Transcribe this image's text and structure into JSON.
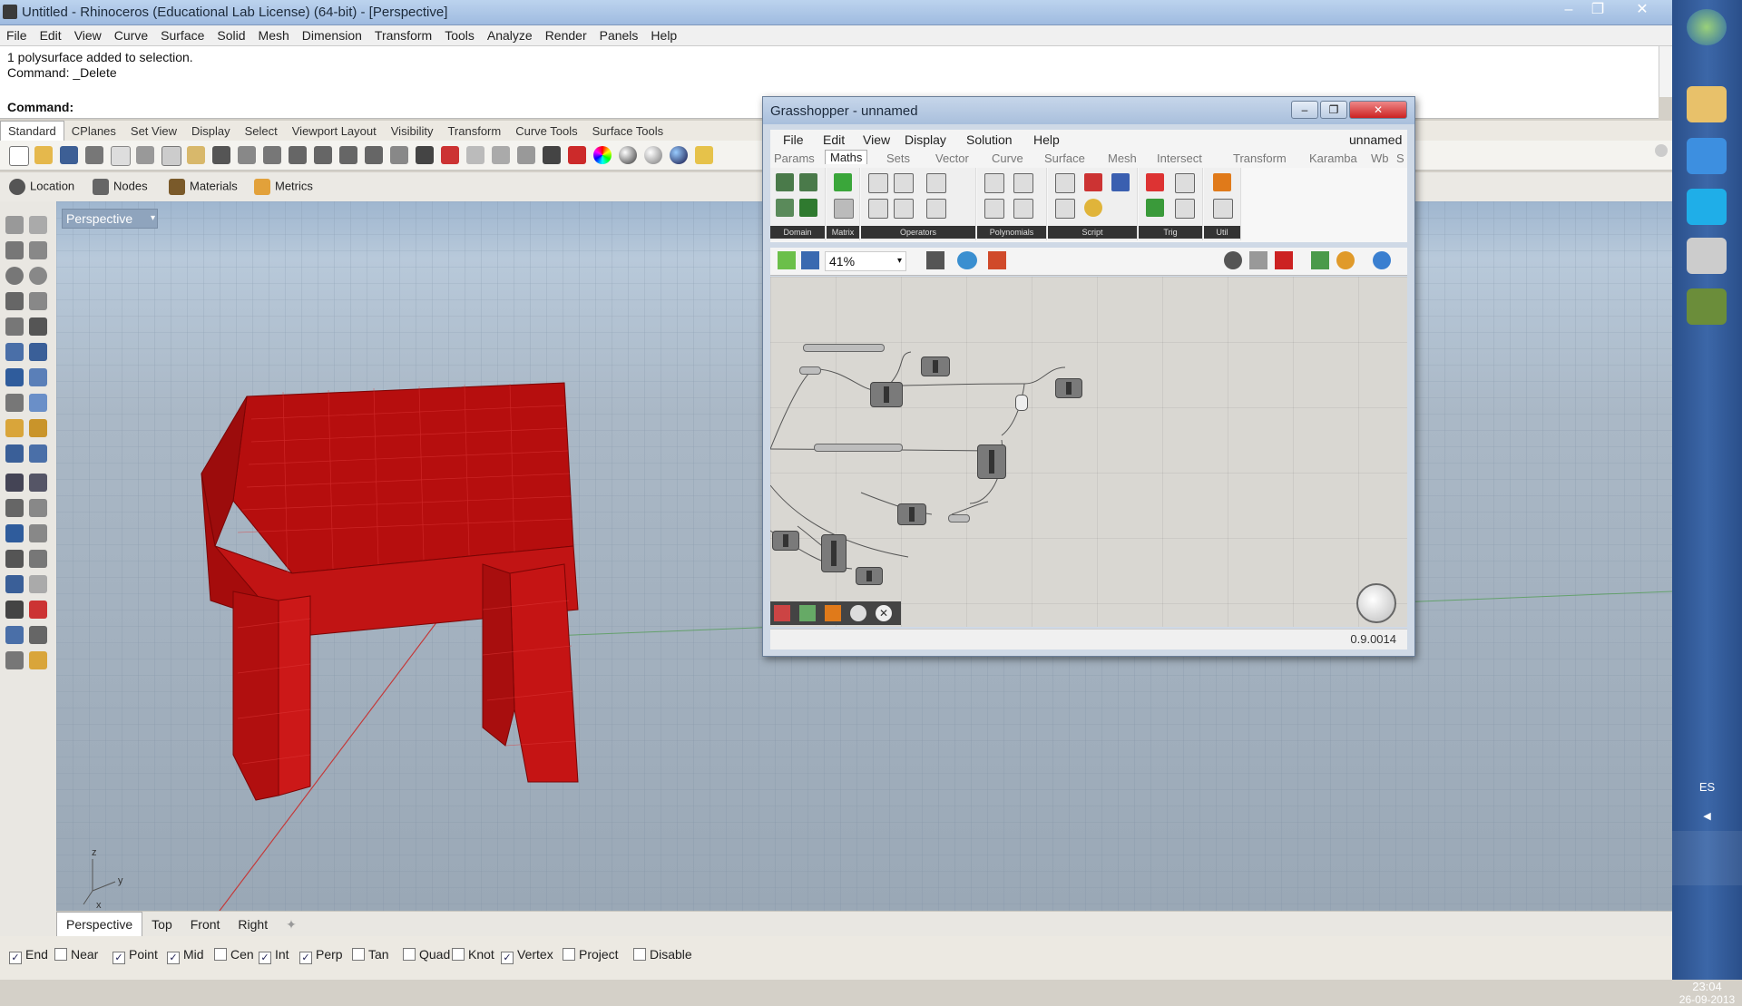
{
  "window": {
    "title": "Untitled - Rhinoceros (Educational Lab License) (64-bit) - [Perspective]",
    "controls": [
      "minimize",
      "restore",
      "close"
    ]
  },
  "menubar": [
    "File",
    "Edit",
    "View",
    "Curve",
    "Surface",
    "Solid",
    "Mesh",
    "Dimension",
    "Transform",
    "Tools",
    "Analyze",
    "Render",
    "Panels",
    "Help"
  ],
  "command": {
    "history": [
      "1 polysurface added to selection.",
      "Command: _Delete"
    ],
    "prompt": "Command:"
  },
  "toolbar_tabs": [
    "Standard",
    "CPlanes",
    "Set View",
    "Display",
    "Select",
    "Viewport Layout",
    "Visibility",
    "Transform",
    "Curve Tools",
    "Surface Tools"
  ],
  "toolbar_tabs_active": "Standard",
  "panels": [
    "Location",
    "Nodes",
    "Materials",
    "Metrics"
  ],
  "viewport": {
    "label": "Perspective",
    "axis_labels": [
      "z",
      "y",
      "x"
    ]
  },
  "viewport_tabs": [
    "Perspective",
    "Top",
    "Front",
    "Right"
  ],
  "viewport_tabs_active": "Perspective",
  "osnaps": [
    {
      "label": "End",
      "checked": true
    },
    {
      "label": "Near",
      "checked": false
    },
    {
      "label": "Point",
      "checked": true
    },
    {
      "label": "Mid",
      "checked": true
    },
    {
      "label": "Cen",
      "checked": false
    },
    {
      "label": "Int",
      "checked": true
    },
    {
      "label": "Perp",
      "checked": true
    },
    {
      "label": "Tan",
      "checked": false
    },
    {
      "label": "Quad",
      "checked": false
    },
    {
      "label": "Knot",
      "checked": false
    },
    {
      "label": "Vertex",
      "checked": true
    },
    {
      "label": "Project",
      "checked": false
    },
    {
      "label": "Disable",
      "checked": false
    }
  ],
  "grasshopper": {
    "title": "Grasshopper - unnamed",
    "doc_name": "unnamed",
    "menu": [
      "File",
      "Edit",
      "View",
      "Display",
      "Solution",
      "Help"
    ],
    "tabs": [
      "Params",
      "Maths",
      "Sets",
      "Vector",
      "Curve",
      "Surface",
      "Mesh",
      "Intersect",
      "Transform",
      "Karamba",
      "Wb",
      "S"
    ],
    "active_tab": "Maths",
    "ribbon_groups": [
      "Domain",
      "Matrix",
      "Operators",
      "Polynomials",
      "Script",
      "Trig",
      "Util"
    ],
    "zoom": "41%",
    "version": "0.9.0014"
  },
  "taskbar": {
    "language": "ES",
    "time": "23:04",
    "date": "26-09-2013"
  },
  "colors": {
    "model_red": "#c01010",
    "viewport_top": "#9fb6cf",
    "taskbar": "#2f568f"
  }
}
